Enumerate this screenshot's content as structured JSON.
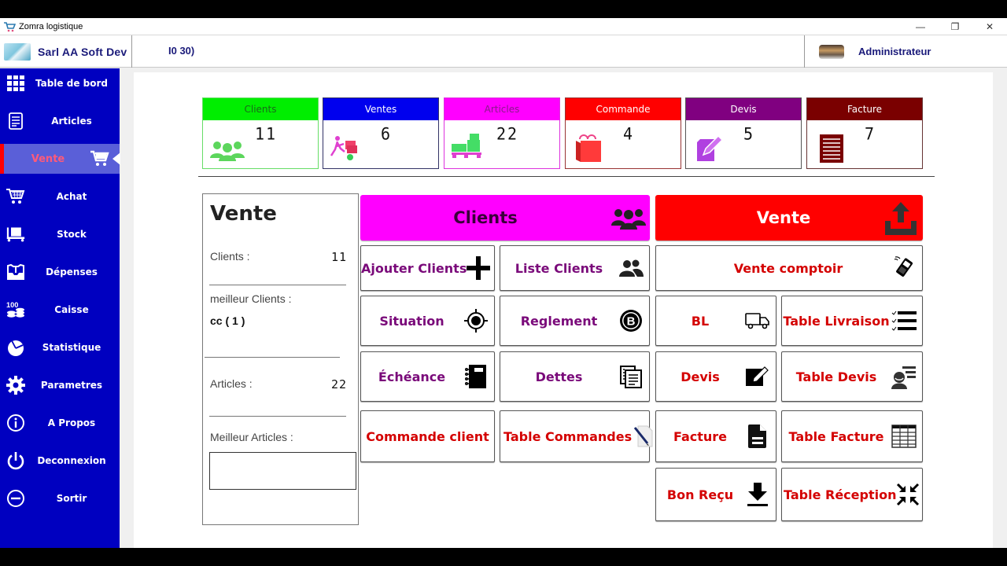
{
  "window": {
    "title": "Zomra logistique",
    "controls": {
      "minimize": "—",
      "maximize": "❐",
      "close": "✕"
    }
  },
  "header": {
    "company_name": "Sarl AA Soft Dev",
    "info": "I0 30)",
    "user_name": "Administrateur"
  },
  "sidebar": {
    "items": [
      {
        "label": "Table de bord",
        "icon": "grid-icon"
      },
      {
        "label": "Articles",
        "icon": "document-icon"
      },
      {
        "label": "Vente",
        "icon": "cart-icon",
        "active": true
      },
      {
        "label": "Achat",
        "icon": "basket-cart-icon"
      },
      {
        "label": "Stock",
        "icon": "pallet-truck-icon"
      },
      {
        "label": "Dépenses",
        "icon": "inbox-icon"
      },
      {
        "label": "Caisse",
        "icon": "coins-icon",
        "icon_text": "100"
      },
      {
        "label": "Statistique",
        "icon": "pie-chart-icon"
      },
      {
        "label": "Parametres",
        "icon": "gear-icon"
      },
      {
        "label": "A Propos",
        "icon": "info-icon"
      },
      {
        "label": "Deconnexion",
        "icon": "power-icon"
      },
      {
        "label": "Sortir",
        "icon": "minus-circle-icon"
      }
    ]
  },
  "stats": [
    {
      "label": "Clients",
      "value": "11",
      "color": "#00ee00",
      "label_color": "#1a6a1a",
      "border": "#66dd66",
      "icon": "users-icon"
    },
    {
      "label": "Ventes",
      "value": "6",
      "color": "#0000ee",
      "label_color": "#ffffff",
      "border": "#333366",
      "icon": "delivery-person-icon"
    },
    {
      "label": "Articles",
      "value": "22",
      "color": "#ff00ff",
      "label_color": "#8a1a8a",
      "border": "#dd33dd",
      "icon": "boxes-pallet-icon"
    },
    {
      "label": "Commande",
      "value": "4",
      "color": "#ff0000",
      "label_color": "#ffffff",
      "border": "#993333",
      "icon": "shopping-bag-icon"
    },
    {
      "label": "Devis",
      "value": "5",
      "color": "#800080",
      "label_color": "#ffffff",
      "border": "#555555",
      "icon": "edit-note-icon"
    },
    {
      "label": "Facture",
      "value": "7",
      "color": "#7a0000",
      "label_color": "#ffffff",
      "border": "#663333",
      "icon": "invoice-icon"
    }
  ],
  "summary": {
    "title": "Vente",
    "clients_label": "Clients :",
    "clients_value": "11",
    "best_client_label": "meilleur  Clients :",
    "best_client_value": "cc ( 1 )",
    "articles_label": "Articles :",
    "articles_value": "22",
    "best_articles_label": "Meilleur Articles :",
    "best_articles_value": ""
  },
  "clients_section": {
    "header": "Clients",
    "header_color": "#ff00ff",
    "buttons": [
      {
        "label": "Ajouter Clients",
        "icon": "plus-icon"
      },
      {
        "label": "Liste Clients",
        "icon": "users-icon"
      },
      {
        "label": "Situation",
        "icon": "crosshair-icon"
      },
      {
        "label": "Reglement",
        "icon": "bitcoin-icon"
      },
      {
        "label": "Échéance",
        "icon": "notebook-icon"
      },
      {
        "label": "Dettes",
        "icon": "documents-icon"
      },
      {
        "label": "Commande client",
        "icon": ""
      },
      {
        "label": "Table Commandes",
        "icon": "pen-paper-icon"
      }
    ]
  },
  "vente_section": {
    "header": "Vente",
    "header_color": "#ff0000",
    "buttons": [
      {
        "label": "Vente comptoir",
        "icon": "barcode-scanner-icon"
      },
      {
        "label": "BL",
        "icon": "truck-icon"
      },
      {
        "label": "Table Livraison",
        "icon": "checklist-icon"
      },
      {
        "label": "Devis",
        "icon": "edit-square-icon"
      },
      {
        "label": "Table Devis",
        "icon": "user-list-icon"
      },
      {
        "label": "Facture",
        "icon": "file-icon"
      },
      {
        "label": "Table Facture",
        "icon": "table-icon"
      },
      {
        "label": "Bon Reçu",
        "icon": "download-icon"
      },
      {
        "label": "Table Réception",
        "icon": "compress-icon"
      }
    ]
  }
}
